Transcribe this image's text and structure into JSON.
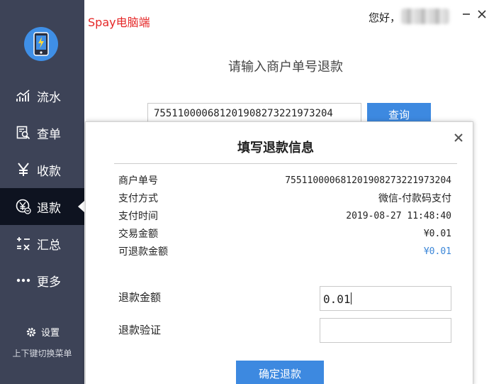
{
  "app": {
    "title": "Spay电脑端",
    "greeting": "您好，"
  },
  "sidebar": {
    "items": [
      {
        "label": "流水",
        "icon": "chart-line-icon"
      },
      {
        "label": "查单",
        "icon": "search-document-icon"
      },
      {
        "label": "收款",
        "icon": "yen-icon"
      },
      {
        "label": "退款",
        "icon": "refund-yen-icon",
        "active": true
      },
      {
        "label": "汇总",
        "icon": "summary-icon"
      },
      {
        "label": "更多",
        "icon": "more-dots-icon"
      }
    ],
    "settings_label": "设置",
    "hint": "上下键切换菜单"
  },
  "main": {
    "prompt": "请输入商户单号退款",
    "order_number": "7551100006812019082732219732​04",
    "query_label": "查询"
  },
  "modal": {
    "title": "填写退款信息",
    "rows": [
      {
        "label": "商户单号",
        "value": "755110000681201908273221973204"
      },
      {
        "label": "支付方式",
        "value": "微信-付款码支付"
      },
      {
        "label": "支付时间",
        "value": "2019-08-27 11:48:40"
      },
      {
        "label": "交易金额",
        "value": "¥0.01"
      },
      {
        "label": "可退款金额",
        "value": "¥0.01"
      }
    ],
    "refund_amount_label": "退款金额",
    "refund_amount_value": "0.01",
    "refund_verify_label": "退款验证",
    "refund_verify_value": "",
    "confirm_label": "确定退款"
  },
  "colors": {
    "accent": "#3d89e0",
    "sidebar": "#3d4357",
    "active": "#0e1320",
    "title_red": "#e52727",
    "refundable_blue": "#3b86d8"
  }
}
